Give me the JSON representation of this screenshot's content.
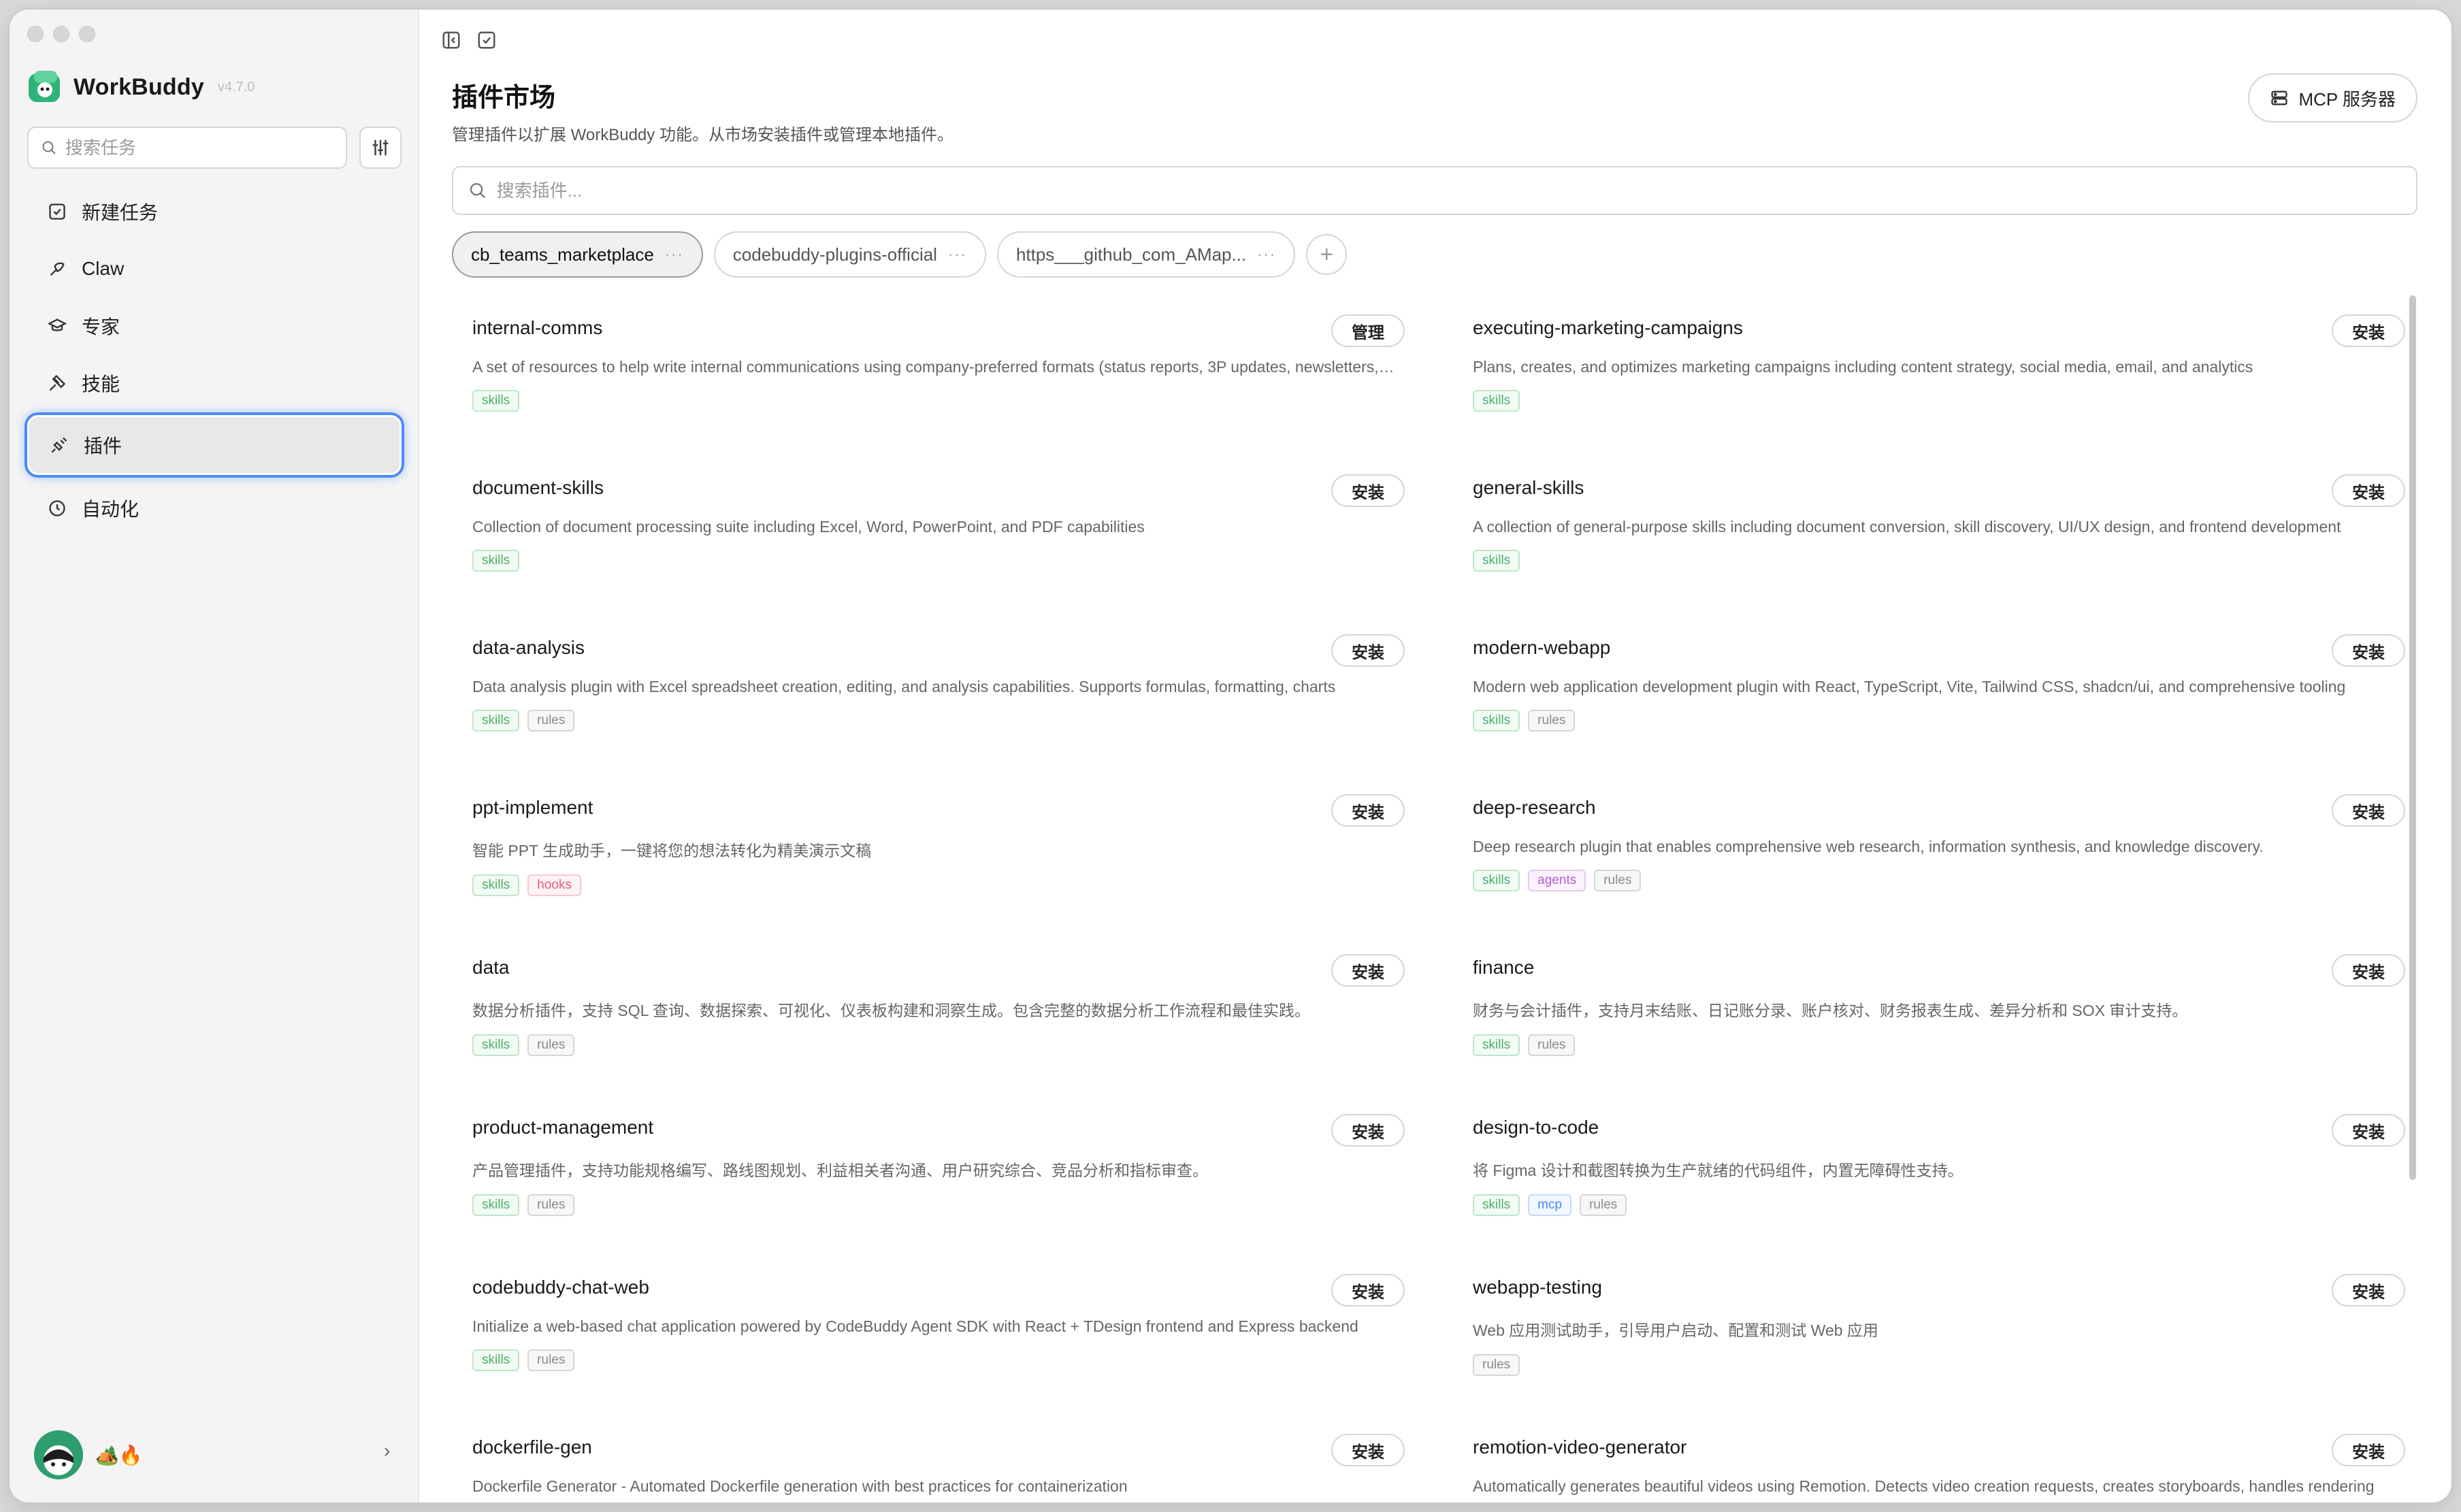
{
  "app": {
    "name": "WorkBuddy",
    "version": "v4.7.0"
  },
  "sidebar": {
    "search_placeholder": "搜索任务",
    "items": [
      {
        "label": "新建任务",
        "icon": "new-task-icon"
      },
      {
        "label": "Claw",
        "icon": "claw-icon"
      },
      {
        "label": "专家",
        "icon": "expert-icon"
      },
      {
        "label": "技能",
        "icon": "skills-icon"
      },
      {
        "label": "插件",
        "icon": "plugin-icon",
        "active": true
      },
      {
        "label": "自动化",
        "icon": "clock-icon"
      }
    ],
    "user": {
      "emoji": "🏕️🔥"
    }
  },
  "main": {
    "title": "插件市场",
    "subtitle": "管理插件以扩展 WorkBuddy 功能。从市场安装插件或管理本地插件。",
    "mcp_button": "MCP 服务器",
    "search_placeholder": "搜索插件...",
    "sources": [
      {
        "label": "cb_teams_marketplace",
        "active": true
      },
      {
        "label": "codebuddy-plugins-official",
        "active": false
      },
      {
        "label": "https___github_com_AMap...",
        "active": false
      }
    ],
    "plugins": [
      {
        "name": "internal-comms",
        "action": "管理",
        "desc": "A set of resources to help write internal communications using company-preferred formats (status reports, 3P updates, newsletters, FAQs)",
        "tags": [
          "skills"
        ]
      },
      {
        "name": "executing-marketing-campaigns",
        "action": "安装",
        "desc": "Plans, creates, and optimizes marketing campaigns including content strategy, social media, email, and analytics",
        "tags": [
          "skills"
        ]
      },
      {
        "name": "document-skills",
        "action": "安装",
        "desc": "Collection of document processing suite including Excel, Word, PowerPoint, and PDF capabilities",
        "tags": [
          "skills"
        ]
      },
      {
        "name": "general-skills",
        "action": "安装",
        "desc": "A collection of general-purpose skills including document conversion, skill discovery, UI/UX design, and frontend development",
        "tags": [
          "skills"
        ]
      },
      {
        "name": "data-analysis",
        "action": "安装",
        "desc": "Data analysis plugin with Excel spreadsheet creation, editing, and analysis capabilities. Supports formulas, formatting, charts",
        "tags": [
          "skills",
          "rules"
        ]
      },
      {
        "name": "modern-webapp",
        "action": "安装",
        "desc": "Modern web application development plugin with React, TypeScript, Vite, Tailwind CSS, shadcn/ui, and comprehensive tooling",
        "tags": [
          "skills",
          "rules"
        ]
      },
      {
        "name": "ppt-implement",
        "action": "安装",
        "desc": "智能 PPT 生成助手，一键将您的想法转化为精美演示文稿",
        "tags": [
          "skills",
          "hooks"
        ]
      },
      {
        "name": "deep-research",
        "action": "安装",
        "desc": "Deep research plugin that enables comprehensive web research, information synthesis, and knowledge discovery.",
        "tags": [
          "skills",
          "agents",
          "rules"
        ]
      },
      {
        "name": "data",
        "action": "安装",
        "desc": "数据分析插件，支持 SQL 查询、数据探索、可视化、仪表板构建和洞察生成。包含完整的数据分析工作流程和最佳实践。",
        "tags": [
          "skills",
          "rules"
        ]
      },
      {
        "name": "finance",
        "action": "安装",
        "desc": "财务与会计插件，支持月末结账、日记账分录、账户核对、财务报表生成、差异分析和 SOX 审计支持。",
        "tags": [
          "skills",
          "rules"
        ]
      },
      {
        "name": "product-management",
        "action": "安装",
        "desc": "产品管理插件，支持功能规格编写、路线图规划、利益相关者沟通、用户研究综合、竞品分析和指标审查。",
        "tags": [
          "skills",
          "rules"
        ]
      },
      {
        "name": "design-to-code",
        "action": "安装",
        "desc": "将 Figma 设计和截图转换为生产就绪的代码组件，内置无障碍性支持。",
        "tags": [
          "skills",
          "mcp",
          "rules"
        ]
      },
      {
        "name": "codebuddy-chat-web",
        "action": "安装",
        "desc": "Initialize a web-based chat application powered by CodeBuddy Agent SDK with React + TDesign frontend and Express backend",
        "tags": [
          "skills",
          "rules"
        ]
      },
      {
        "name": "webapp-testing",
        "action": "安装",
        "desc": "Web 应用测试助手，引导用户启动、配置和测试 Web 应用",
        "tags": [
          "rules"
        ]
      },
      {
        "name": "dockerfile-gen",
        "action": "安装",
        "desc": "Dockerfile Generator - Automated Dockerfile generation with best practices for containerization",
        "tags": []
      },
      {
        "name": "remotion-video-generator",
        "action": "安装",
        "desc": "Automatically generates beautiful videos using Remotion. Detects video creation requests, creates storyboards, handles rendering",
        "tags": []
      }
    ]
  }
}
